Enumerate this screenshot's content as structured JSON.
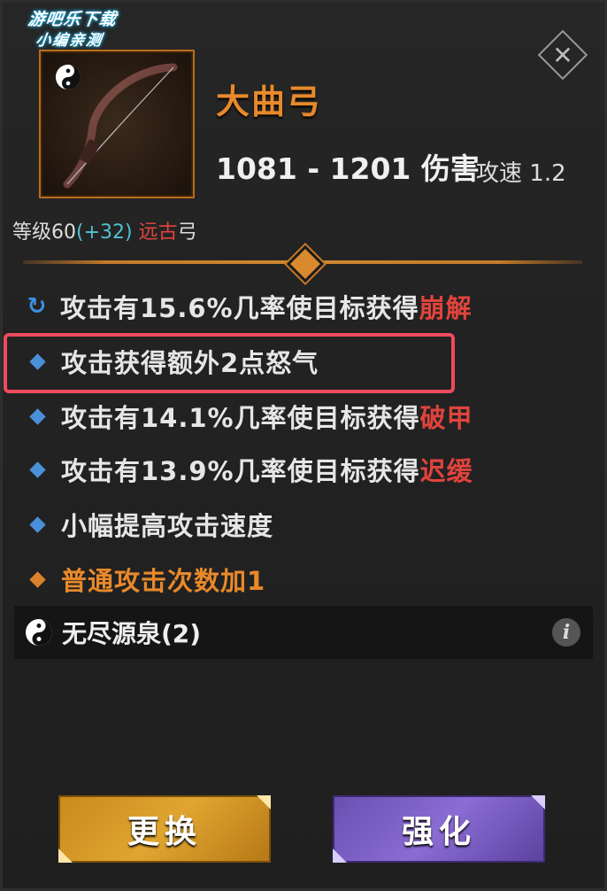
{
  "watermark": {
    "line1": "游吧乐下载",
    "line2": "小编亲测"
  },
  "item": {
    "name": "大曲弓",
    "damage": "1081 - 1201 伤害",
    "speed_label": "攻速",
    "speed_value": "1.2",
    "level_label": "等级60",
    "level_bonus": "(+32)",
    "rarity": "远古",
    "type": "弓"
  },
  "affixes": [
    {
      "prefix": "攻击有15.6%几率使目标获得",
      "effect": "崩解",
      "bullet": "refresh-icon"
    },
    {
      "prefix": "攻击获得额外2点怒气",
      "effect": "",
      "bullet": "blue-diamond"
    },
    {
      "prefix": "攻击有14.1%几率使目标获得",
      "effect": "破甲",
      "bullet": "blue-diamond"
    },
    {
      "prefix": "攻击有13.9%几率使目标获得",
      "effect": "迟缓",
      "bullet": "blue-diamond"
    },
    {
      "prefix": "小幅提高攻击速度",
      "effect": "",
      "bullet": "blue-diamond"
    },
    {
      "prefix": "普通攻击次数加1",
      "effect": "",
      "bullet": "orange-diamond"
    }
  ],
  "set": {
    "label": "无尽源泉(2)",
    "info": "i"
  },
  "buttons": {
    "replace": "更换",
    "upgrade": "强化"
  },
  "colors": {
    "name": "#e8892b",
    "effect_red": "#e0443c",
    "bonus_cyan": "#4fc3d0",
    "highlight": "#f04a5e",
    "replace_btn": "#e0a530",
    "upgrade_btn": "#8a6cd4"
  }
}
